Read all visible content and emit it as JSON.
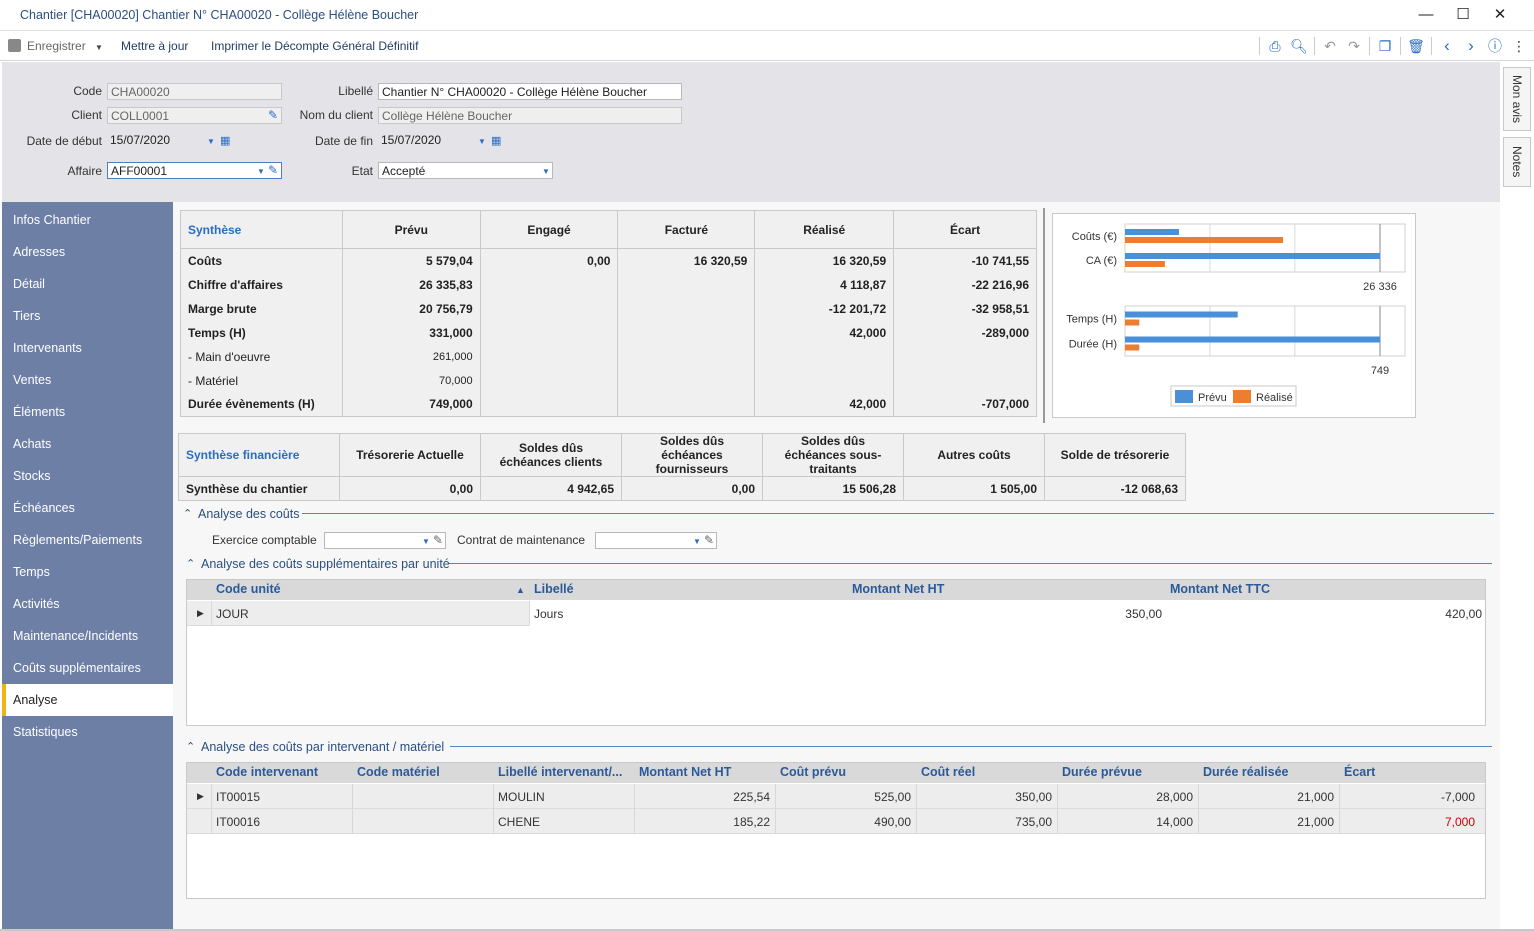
{
  "window": {
    "title": "Chantier [CHA00020] Chantier N° CHA00020 - Collège Hélène Boucher",
    "minimize": "—",
    "maximize": "☐",
    "close": "✕"
  },
  "toolbar": {
    "save": "Enregistrer",
    "update": "Mettre à jour",
    "print_final": "Imprimer le Décompte Général Définitif",
    "icons": [
      "print-icon",
      "preview-icon",
      "undo-icon",
      "redo-icon",
      "copy-icon",
      "delete-icon",
      "prev-icon",
      "next-icon",
      "help-icon",
      "more-icon"
    ]
  },
  "header": {
    "code_label": "Code",
    "code_value": "CHA00020",
    "client_label": "Client",
    "client_value": "COLL0001",
    "start_label": "Date de début",
    "start_value": "15/07/2020",
    "affaire_label": "Affaire",
    "affaire_value": "AFF00001",
    "libelle_label": "Libellé",
    "libelle_value": "Chantier N° CHA00020 - Collège Hélène Boucher",
    "client_name_label": "Nom du client",
    "client_name_value": "Collège Hélène Boucher",
    "end_label": "Date de fin",
    "end_value": "15/07/2020",
    "etat_label": "Etat",
    "etat_value": "Accepté"
  },
  "sidetabs": {
    "avis": "Mon avis",
    "notes": "Notes"
  },
  "sidebar": {
    "items": [
      {
        "label": "Infos Chantier"
      },
      {
        "label": "Adresses"
      },
      {
        "label": "Détail"
      },
      {
        "label": "Tiers"
      },
      {
        "label": "Intervenants"
      },
      {
        "label": "Ventes"
      },
      {
        "label": "Éléments"
      },
      {
        "label": "Achats"
      },
      {
        "label": "Stocks"
      },
      {
        "label": "Échéances"
      },
      {
        "label": "Règlements/Paiements"
      },
      {
        "label": "Temps"
      },
      {
        "label": "Activités"
      },
      {
        "label": "Maintenance/Incidents"
      },
      {
        "label": "Coûts supplémentaires"
      },
      {
        "label": "Analyse"
      },
      {
        "label": "Statistiques"
      }
    ],
    "active": "Analyse"
  },
  "synthese": {
    "headers": [
      "Synthèse",
      "Prévu",
      "Engagé",
      "Facturé",
      "Réalisé",
      "Écart"
    ],
    "rows": [
      {
        "label": "Coûts",
        "prevu": "5 579,04",
        "engage": "0,00",
        "facture": "16 320,59",
        "realise": "16 320,59",
        "ecart": "-10 741,55"
      },
      {
        "label": "Chiffre d'affaires",
        "prevu": "26 335,83",
        "engage": "",
        "facture": "",
        "realise": "4 118,87",
        "ecart": "-22 216,96"
      },
      {
        "label": "Marge brute",
        "prevu": "20 756,79",
        "engage": "",
        "facture": "",
        "realise": "-12 201,72",
        "ecart": "-32 958,51"
      },
      {
        "label": "Temps (H)",
        "prevu": "331,000",
        "engage": "",
        "facture": "",
        "realise": "42,000",
        "ecart": "-289,000"
      },
      {
        "label": " - Main d'oeuvre",
        "prevu": "261,000",
        "engage": "",
        "facture": "",
        "realise": "",
        "ecart": ""
      },
      {
        "label": " - Matériel",
        "prevu": "70,000",
        "engage": "",
        "facture": "",
        "realise": "",
        "ecart": ""
      },
      {
        "label": "Durée évènements (H)",
        "prevu": "749,000",
        "engage": "",
        "facture": "",
        "realise": "42,000",
        "ecart": "-707,000"
      }
    ]
  },
  "chart_data": [
    {
      "type": "bar",
      "orientation": "horizontal",
      "categories": [
        "Coûts (€)",
        "CA (€)"
      ],
      "series": [
        {
          "name": "Prévu",
          "values": [
            5579.04,
            26335.83
          ]
        },
        {
          "name": "Réalisé",
          "values": [
            16320.59,
            4118.87
          ]
        }
      ],
      "xlim": [
        0,
        26336
      ],
      "tick_label": "26 336",
      "colors": {
        "Prévu": "#4a90d9",
        "Réalisé": "#ed7d31"
      }
    },
    {
      "type": "bar",
      "orientation": "horizontal",
      "categories": [
        "Temps (H)",
        "Durée (H)"
      ],
      "series": [
        {
          "name": "Prévu",
          "values": [
            331,
            749
          ]
        },
        {
          "name": "Réalisé",
          "values": [
            42,
            42
          ]
        }
      ],
      "xlim": [
        0,
        749
      ],
      "tick_label": "749",
      "colors": {
        "Prévu": "#4a90d9",
        "Réalisé": "#ed7d31"
      },
      "legend": "bottom"
    }
  ],
  "legend": {
    "prevu": "Prévu",
    "realise": "Réalisé"
  },
  "financiere": {
    "headers": [
      "Synthèse financière",
      "Trésorerie Actuelle",
      "Soldes dûs échéances clients",
      "Soldes dûs échéances fournisseurs",
      "Soldes dûs échéances sous-traitants",
      "Autres coûts",
      "Solde de trésorerie"
    ],
    "row": [
      "Synthèse du chantier",
      "0,00",
      "4 942,65",
      "0,00",
      "15 506,28",
      "1 505,00",
      "-12 068,63"
    ]
  },
  "analyse": {
    "title": "Analyse des coûts",
    "exercice_label": "Exercice comptable",
    "exercice_value": "",
    "contrat_label": "Contrat de maintenance",
    "contrat_value": ""
  },
  "unite": {
    "title": "Analyse des coûts supplémentaires par unité",
    "headers": [
      "Code unité",
      "Libellé",
      "Montant Net HT",
      "Montant Net TTC"
    ],
    "rows": [
      {
        "code": "JOUR",
        "libelle": "Jours",
        "ht": "350,00",
        "ttc": "420,00"
      }
    ]
  },
  "intervenant": {
    "title": "Analyse des coûts par intervenant / matériel",
    "headers": [
      "Code intervenant",
      "Code matériel",
      "Libellé intervenant/...",
      "Montant Net HT",
      "Coût prévu",
      "Coût réel",
      "Durée prévue",
      "Durée réalisée",
      "Écart"
    ],
    "rows": [
      {
        "code": "IT00015",
        "materiel": "",
        "libelle": "MOULIN",
        "ht": "225,54",
        "prevu": "525,00",
        "reel": "350,00",
        "duree_prevue": "28,000",
        "duree_realisee": "21,000",
        "ecart": "-7,000"
      },
      {
        "code": "IT00016",
        "materiel": "",
        "libelle": "CHENE",
        "ht": "185,22",
        "prevu": "490,00",
        "reel": "735,00",
        "duree_prevue": "14,000",
        "duree_realisee": "21,000",
        "ecart": "7,000"
      }
    ],
    "negative_color": "#cc0000"
  }
}
